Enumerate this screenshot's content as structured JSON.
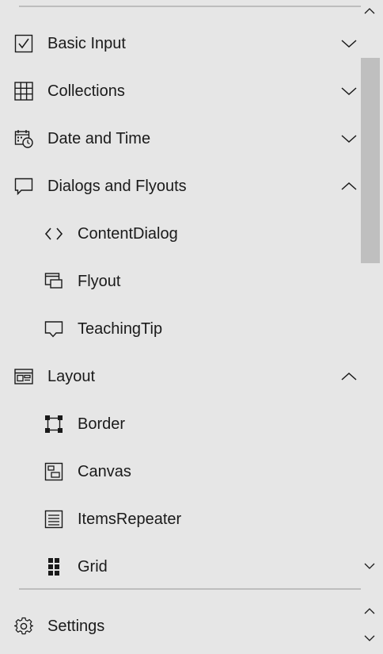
{
  "nav": {
    "items": [
      {
        "label": "Basic Input",
        "icon": "checkbox-icon",
        "expanded": false
      },
      {
        "label": "Collections",
        "icon": "grid-table-icon",
        "expanded": false
      },
      {
        "label": "Date and Time",
        "icon": "calendar-clock-icon",
        "expanded": false
      },
      {
        "label": "Dialogs and Flyouts",
        "icon": "speech-bubble-icon",
        "expanded": true,
        "children": [
          {
            "label": "ContentDialog",
            "icon": "code-brackets-icon"
          },
          {
            "label": "Flyout",
            "icon": "flyout-window-icon"
          },
          {
            "label": "TeachingTip",
            "icon": "teaching-tip-icon"
          }
        ]
      },
      {
        "label": "Layout",
        "icon": "layout-icon",
        "expanded": true,
        "children": [
          {
            "label": "Border",
            "icon": "border-icon"
          },
          {
            "label": "Canvas",
            "icon": "canvas-icon"
          },
          {
            "label": "ItemsRepeater",
            "icon": "items-repeater-icon"
          },
          {
            "label": "Grid",
            "icon": "grid-icon"
          }
        ]
      }
    ]
  },
  "footer": {
    "settings_label": "Settings",
    "settings_icon": "gear-icon"
  },
  "colors": {
    "background": "#e6e6e6",
    "text": "#1a1a1a",
    "divider": "#bdbdbd",
    "scroll_thumb": "#bfbfbf"
  }
}
